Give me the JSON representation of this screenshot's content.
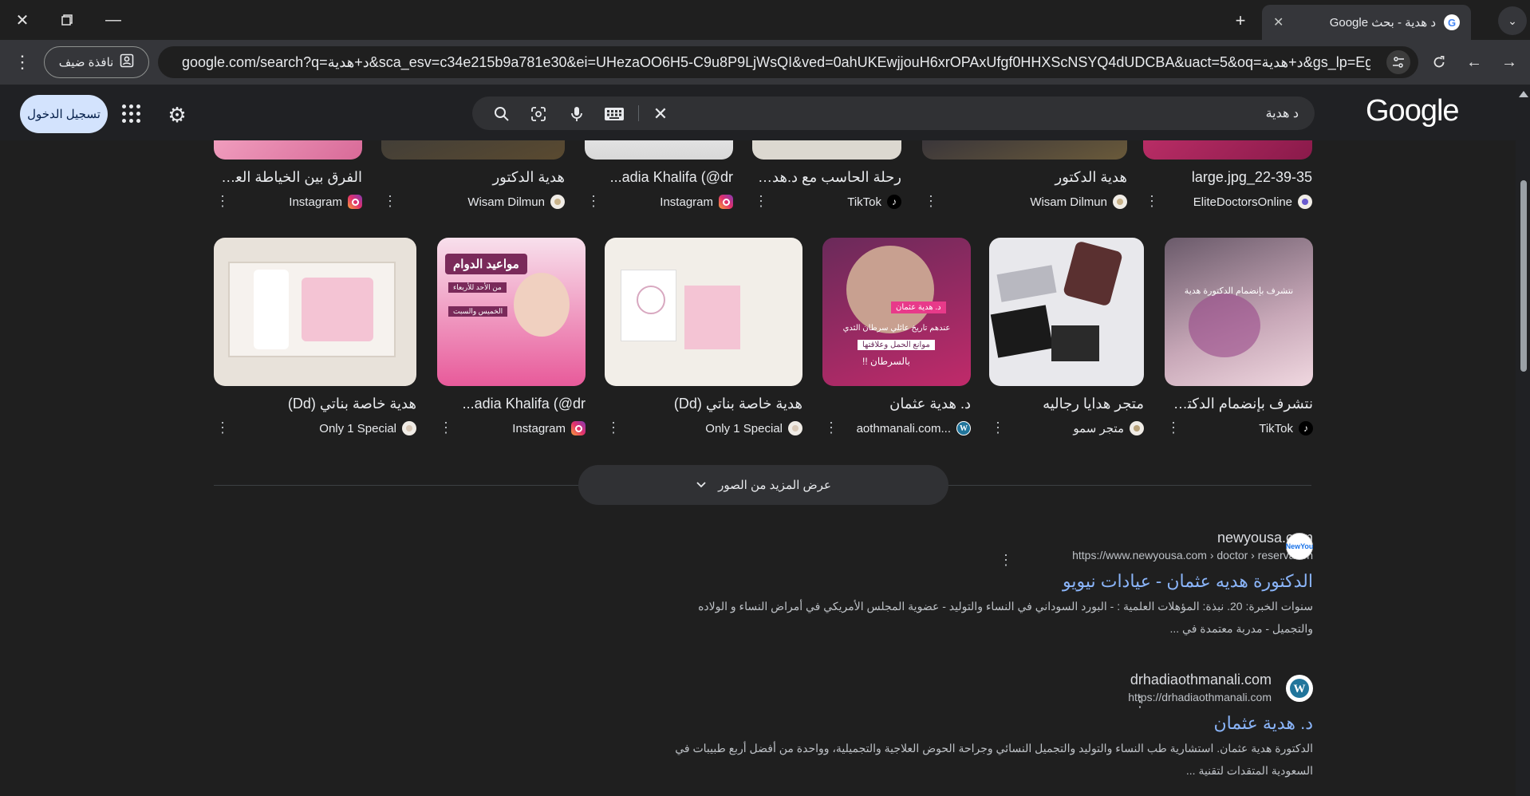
{
  "window": {
    "tab_title": "د هدية - بحث Google",
    "close_tab_glyph": "✕",
    "new_tab_glyph": "+",
    "tab_menu_glyph": "⌄"
  },
  "toolbar": {
    "url": "google.com/search?q=د+هدية&sca_esv=c34e215b9a781e30&ei=UHezaOO6H5-C9u8P9LjWsQI&ved=0ahUKEwjjouH6xrOPAxUfgf0HHXScNSYQ4dUDCBA&uact=5&oq=د+هدية&gs_lp=Egxn...",
    "guest_label": "نافذة ضيف",
    "menu_glyph": "⋮"
  },
  "header": {
    "logo": "Google",
    "query": "د هدية",
    "signin_label": "تسجيل الدخول"
  },
  "images": {
    "row1": [
      {
        "title": "large.jpg_22-39-35",
        "source": "EliteDoctorsOnline",
        "icon": "elite-icon",
        "color": "#6a5acd"
      },
      {
        "title": "هدية الدكتور",
        "source": "Wisam Dilmun",
        "icon": "wisam-icon",
        "color": "#c9b38a"
      },
      {
        "title": "رحلة الحاسب مع د.هديةـ...",
        "source": "TikTok",
        "icon": "tiktok-icon",
        "color": "#000000"
      },
      {
        "title": "adia Khalifa (@dr...",
        "source": "Instagram",
        "icon": "instagram-icon",
        "color": "#e1306c"
      },
      {
        "title": "هدية الدكتور",
        "source": "Wisam Dilmun",
        "icon": "wisam-icon",
        "color": "#c9b38a"
      },
      {
        "title": "الفرق بين الخياطة العادية...",
        "source": "Instagram",
        "icon": "instagram-icon",
        "color": "#e1306c"
      }
    ],
    "row2": [
      {
        "title": "نتشرف بإنضمام الدكتوره...",
        "source": "TikTok",
        "icon": "tiktok-icon",
        "color": "#000000"
      },
      {
        "title": "متجر هدايا رجاليه",
        "source": "متجر سمو",
        "icon": "store-icon",
        "color": "#b8a27a"
      },
      {
        "title": "د. هدية عثمان",
        "source": "...aothmanali.com",
        "icon": "wordpress-icon",
        "color": "#21759b"
      },
      {
        "title": "هدية خاصة بناتي (Dd)",
        "source": "Only 1 Special",
        "icon": "special-icon",
        "color": "#d9c9b8"
      },
      {
        "title": "adia Khalifa (@dr...",
        "source": "Instagram",
        "icon": "instagram-icon",
        "color": "#e1306c"
      },
      {
        "title": "هدية خاصة بناتي (Dd)",
        "source": "Only 1 Special",
        "icon": "special-icon",
        "color": "#d9c9b8"
      }
    ],
    "thumb_texts": {
      "hours_title": "مواعيد الدوام",
      "hours_line1": "من الأحد للأربعاء",
      "hours_line2": "الخميس والسبت",
      "cancer_badge": "د. هدية عثمان",
      "cancer_line1": "عندهم تاريخ عائلي سرطان الثدي",
      "cancer_line2": "موانع الحمل وعلاقتها",
      "cancer_line3": "بالسرطان !!",
      "row1_pink_label": "الفرق بين",
      "tiktok_caption": "نتشرف بإنضمام الدكتورة هدية"
    },
    "more_label": "عرض المزيد من الصور"
  },
  "results": [
    {
      "site": "newyousa.com",
      "cite": "https://www.newyousa.com › doctor › reservation",
      "favicon_text": "NewYou",
      "title": "الدكتورة هديه عثمان - عيادات نيويو",
      "snippet_line1": "سنوات الخبرة: 20. نبذة: المؤهلات العلمية : - البورد السوداني في النساء والتوليد - عضوية المجلس الأمريكي في أمراض النساء و الولاده",
      "snippet_line2": "والتجميل - مدربة معتمدة في ..."
    },
    {
      "site": "drhadiaothmanali.com",
      "cite": "https://drhadiaothmanali.com",
      "favicon_text": "W",
      "title": "د. هدية عثمان",
      "snippet_line1": "الدكتورة هدية عثمان. استشارية طب النساء والتوليد والتجميل النسائي وجراحة الحوض العلاجية والتجميلية، وواحدة من أفضل أربع طبيبات في",
      "snippet_line2": "السعودية المتقدات لتقنية ..."
    }
  ]
}
